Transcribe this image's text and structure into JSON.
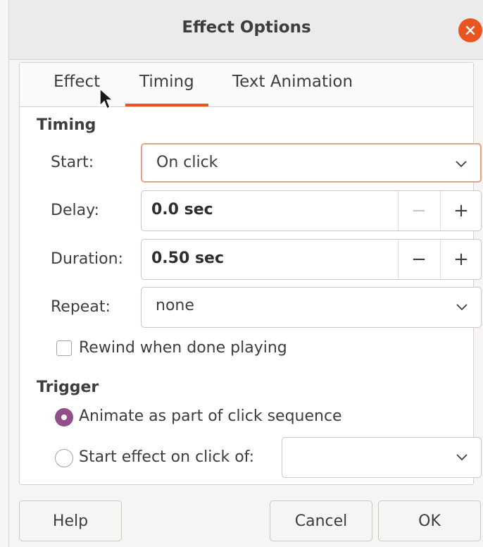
{
  "dialog": {
    "title": "Effect Options"
  },
  "tabs": [
    {
      "label": "Effect",
      "active": false
    },
    {
      "label": "Timing",
      "active": true
    },
    {
      "label": "Text Animation",
      "active": false
    }
  ],
  "timing": {
    "section_title": "Timing",
    "start": {
      "label": "Start:",
      "value": "On click"
    },
    "delay": {
      "label": "Delay:",
      "value": "0.0 sec"
    },
    "duration": {
      "label": "Duration:",
      "value": "0.50 sec"
    },
    "repeat": {
      "label": "Repeat:",
      "value": "none"
    },
    "rewind": {
      "label": "Rewind when done playing",
      "checked": false
    }
  },
  "trigger": {
    "section_title": "Trigger",
    "animate_as_part": {
      "label": "Animate as part of click sequence",
      "selected": true
    },
    "start_on_click_of": {
      "label": "Start effect on click of:",
      "selected": false,
      "value": ""
    }
  },
  "buttons": {
    "help": "Help",
    "cancel": "Cancel",
    "ok": "OK"
  },
  "colors": {
    "accent": "#e95420",
    "radio_selected": "#924d8b"
  },
  "icons": {
    "close": "close-icon",
    "dropdown": "chevron-down-icon",
    "minus": "minus-icon",
    "plus": "plus-icon",
    "cursor": "mouse-pointer-icon"
  }
}
